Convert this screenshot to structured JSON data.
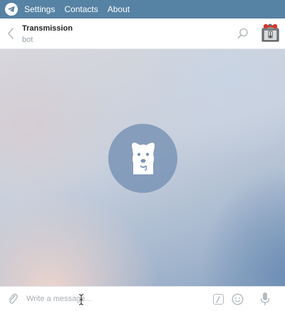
{
  "app": {
    "logo_icon": "telegram-logo-icon",
    "nav": [
      {
        "label": "Settings"
      },
      {
        "label": "Contacts"
      },
      {
        "label": "About"
      }
    ],
    "colors": {
      "accent": "#5682a3",
      "bot_badge": "#7a94b6"
    }
  },
  "chat": {
    "peer_name": "Transmission",
    "peer_status": "bot",
    "back_icon": "chevron-left-icon",
    "search_icon": "search-icon",
    "avatar_icon": "transmission-avatar",
    "empty_state_icon": "bot-dog-icon"
  },
  "composer": {
    "placeholder": "Write a message...",
    "value": "",
    "attach_icon": "paperclip-icon",
    "command_icon": "slash-command-icon",
    "emoji_icon": "smile-icon",
    "mic_icon": "microphone-icon"
  }
}
